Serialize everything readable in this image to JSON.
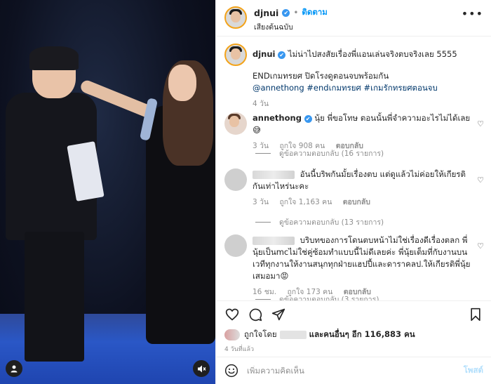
{
  "media": {
    "tag_icon": "person-icon",
    "mute_icon": "speaker-muted-icon"
  },
  "header": {
    "username": "djnui",
    "verified": "✔",
    "separator": "•",
    "follow_label": "ติดตาม",
    "audio_label": "เสียงต้นฉบับ",
    "more_icon": "more-horizontal-icon"
  },
  "caption": {
    "username": "djnui",
    "verified": "✔",
    "line1": "ไม่น่าไปสงสัยเรื่องพี่แอนเล่นจริงตบจริงเลย 5555",
    "line2": "ENDเกมทรยศ ปิดโรงดูตอนจบพร้อมกัน",
    "tags": "@annethong #endเกมทรยศ #เกมรักทรยศตอนจบ",
    "time": "4 วัน"
  },
  "comments": [
    {
      "username": "annethong",
      "verified": "✔",
      "text": "นุ้ย พี่ขอโทษ ตอนนั้นพี่จำความอะไรไม่ได้เลย 😅",
      "time": "3 วัน",
      "likes": "ถูกใจ 908 คน",
      "reply_label": "ตอบกลับ",
      "view_replies": "ดูข้อความตอบกลับ (16 รายการ)"
    },
    {
      "username": "",
      "text": "อันนี้บริพกันมั้ยเรื่องตบ แต่ดูแล้วไม่ค่อยให้เกียรติกันเท่าไหร่นะคะ",
      "time": "3 วัน",
      "likes": "ถูกใจ 1,163 คน",
      "reply_label": "ตอบกลับ",
      "view_replies": "ดูข้อความตอบกลับ (13 รายการ)"
    },
    {
      "username": "",
      "text": "บริบทของการโดนตบหน้าไม่ใช่เรื่องดีเรื่องตลก พี่นุ้ยเป็นmcไม่ใช่คู่ซ้อมทำแบบนี้ไม่ดีเลยค่ะ พี่นุ้ยเต็มที่กับงานบนเวทีทุกงานให้งานสนุกทุกฝ่ายแฮปปี้และดาราคลป.ให้เกียรติพี่นุ้ยเสมอมา😡",
      "time": "16 ชม.",
      "likes": "ถูกใจ 173 คน",
      "reply_label": "ตอบกลับ",
      "view_replies": "ดูข้อความตอบกลับ (3 รายการ)"
    }
  ],
  "actions": {
    "like_icon": "heart-icon",
    "comment_icon": "comment-icon",
    "share_icon": "send-icon",
    "save_icon": "bookmark-icon"
  },
  "likes": {
    "prefix": "ถูกใจโดย",
    "suffix": "และคนอื่นๆ อีก 116,883 คน"
  },
  "post_age": "4 วันที่แล้ว",
  "add_comment": {
    "emoji_icon": "smiley-icon",
    "placeholder": "เพิ่มความคิดเห็น",
    "post_label": "โพสต์"
  },
  "colors": {
    "accent": "#0095f6",
    "verified": "#3897f0",
    "muted": "#8e8e8e"
  }
}
